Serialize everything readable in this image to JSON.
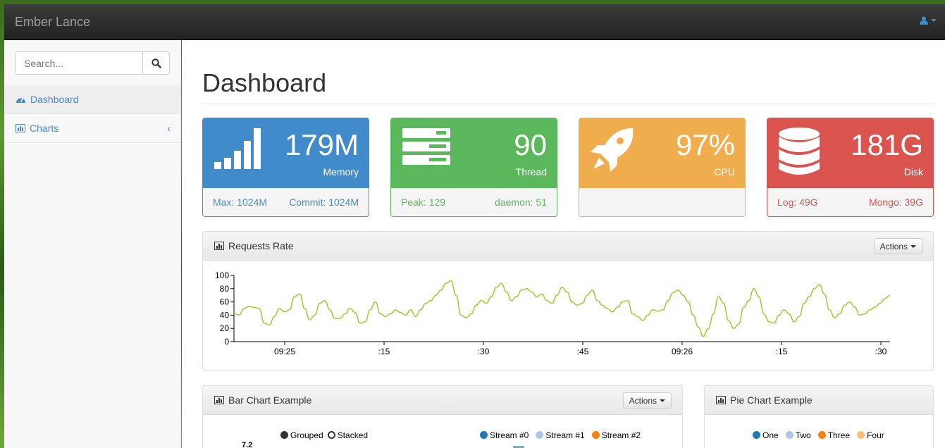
{
  "navbar": {
    "brand": "Ember Lance"
  },
  "sidebar": {
    "search_placeholder": "Search...",
    "items": [
      {
        "label": "Dashboard",
        "icon": "dashboard-icon"
      },
      {
        "label": "Charts",
        "icon": "bar-chart-icon"
      }
    ]
  },
  "page": {
    "title": "Dashboard"
  },
  "stats": [
    {
      "value": "179M",
      "label": "Memory",
      "foot_left": "Max: 1024M",
      "foot_right": "Commit: 1024M",
      "color": "#428bca"
    },
    {
      "value": "90",
      "label": "Thread",
      "foot_left": "Peak: 129",
      "foot_right": "daemon: 51",
      "color": "#5cb85c"
    },
    {
      "value": "97%",
      "label": "CPU",
      "foot_left": "",
      "foot_right": "",
      "color": "#f0ad4e"
    },
    {
      "value": "181G",
      "label": "Disk",
      "foot_left": "Log: 49G",
      "foot_right": "Mongo: 39G",
      "color": "#d9534f"
    }
  ],
  "panels": {
    "requests": {
      "title": "Requests Rate",
      "actions": "Actions"
    },
    "bar": {
      "title": "Bar Chart Example",
      "actions": "Actions",
      "mode_grouped": "Grouped",
      "mode_stacked": "Stacked",
      "legend": [
        "Stream #0",
        "Stream #1",
        "Stream #2"
      ],
      "y_top": "7.2"
    },
    "pie": {
      "title": "Pie Chart Example",
      "legend": [
        "One",
        "Two",
        "Three",
        "Four"
      ]
    }
  },
  "chart_data": {
    "type": "line",
    "title": "",
    "ylim": [
      0,
      100
    ],
    "y_ticks": [
      "0",
      "20",
      "40",
      "60",
      "80",
      "100"
    ],
    "x_ticks": [
      "09:25",
      ":15",
      ":30",
      ":45",
      "09:26",
      ":15",
      ":30"
    ],
    "series": [
      {
        "color": "#9acd32",
        "values": [
          42,
          40,
          50,
          53,
          52,
          50,
          28,
          25,
          38,
          50,
          45,
          48,
          68,
          72,
          50,
          33,
          40,
          58,
          62,
          48,
          35,
          35,
          42,
          50,
          44,
          28,
          30,
          48,
          60,
          42,
          38,
          42,
          48,
          44,
          40,
          48,
          38,
          48,
          58,
          62,
          70,
          78,
          88,
          92,
          70,
          40,
          36,
          42,
          55,
          62,
          58,
          68,
          82,
          88,
          75,
          62,
          68,
          78,
          80,
          75,
          68,
          72,
          62,
          58,
          70,
          82,
          75,
          60,
          55,
          58,
          70,
          78,
          62,
          55,
          50,
          45,
          52,
          60,
          62,
          42,
          38,
          32,
          40,
          48,
          46,
          48,
          62,
          74,
          78,
          70,
          60,
          40,
          22,
          8,
          20,
          42,
          68,
          58,
          32,
          20,
          26,
          52,
          62,
          80,
          68,
          42,
          30,
          28,
          40,
          48,
          42,
          30,
          38,
          58,
          68,
          80,
          86,
          72,
          48,
          36,
          42,
          55,
          60,
          52,
          40,
          42,
          48,
          52,
          58,
          65,
          70
        ]
      }
    ]
  },
  "colors": {
    "primary": "#428bca",
    "success": "#5cb85c",
    "warning": "#f0ad4e",
    "danger": "#d9534f",
    "line": "#9acd32"
  }
}
